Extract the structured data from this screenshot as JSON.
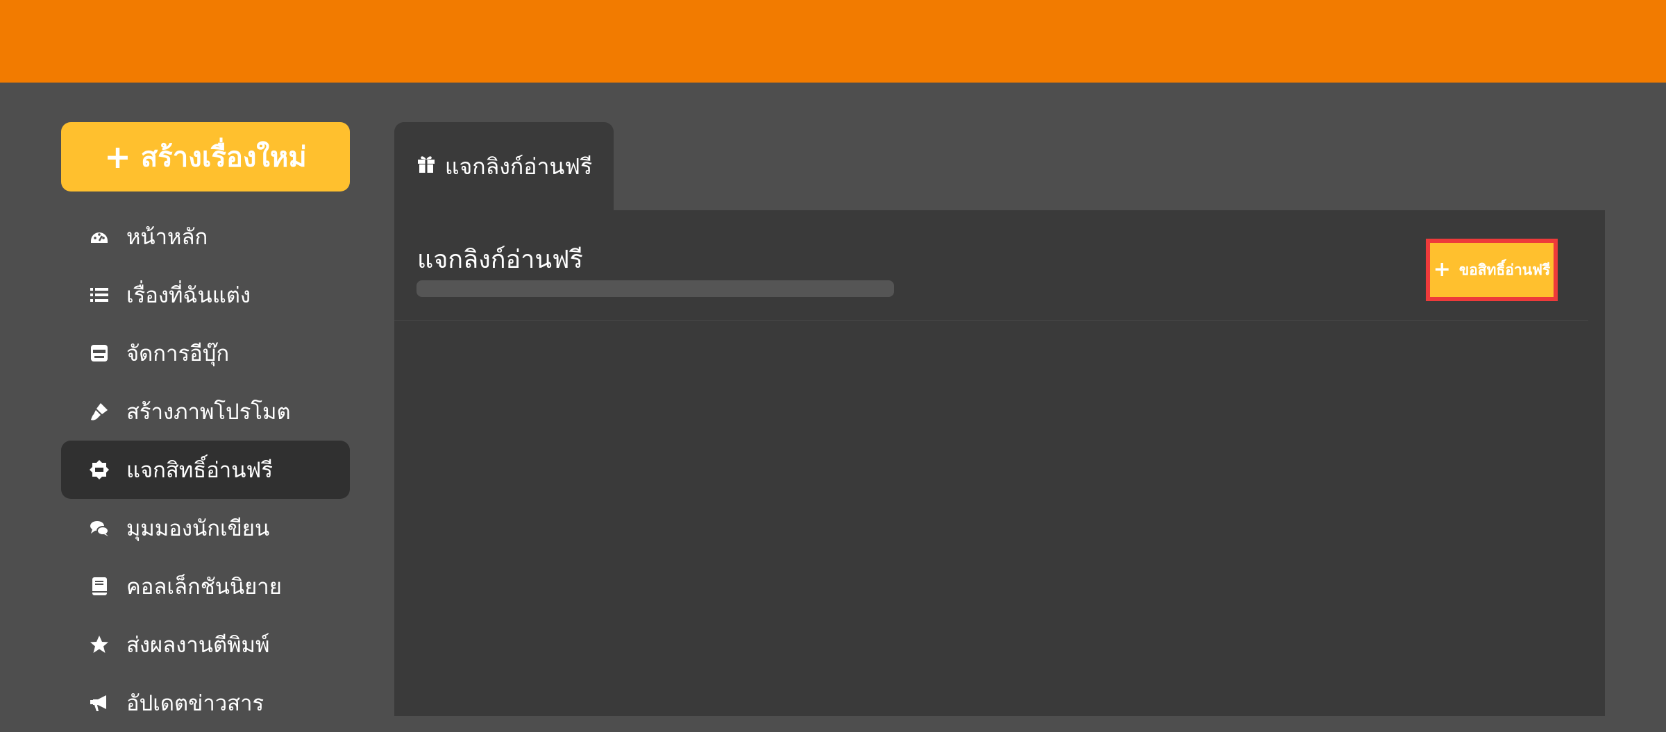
{
  "sidebar": {
    "create_label": "สร้างเรื่องใหม่",
    "items": [
      {
        "label": "หน้าหลัก",
        "icon": "dashboard-icon"
      },
      {
        "label": "เรื่องที่ฉันแต่ง",
        "icon": "list-icon"
      },
      {
        "label": "จัดการอีบุ๊ก",
        "icon": "ebook-icon"
      },
      {
        "label": "สร้างภาพโปรโมต",
        "icon": "brush-icon"
      },
      {
        "label": "แจกสิทธิ์อ่านฟรี",
        "icon": "free-badge-icon",
        "active": true
      },
      {
        "label": "มุมมองนักเขียน",
        "icon": "comments-icon"
      },
      {
        "label": "คอลเล็กชันนิยาย",
        "icon": "book-icon"
      },
      {
        "label": "ส่งผลงานตีพิมพ์",
        "icon": "star-icon"
      },
      {
        "label": "อัปเดตข่าวสาร",
        "icon": "megaphone-icon"
      }
    ]
  },
  "main": {
    "tab_label": "แจกลิงก์อ่านฟรี",
    "panel_title": "แจกลิงก์อ่านฟรี",
    "request_button": "ขอสิทธิ์อ่านฟรี"
  },
  "colors": {
    "header": "#f27b00",
    "accent": "#ffc02e",
    "highlight": "#ee3a3a"
  }
}
